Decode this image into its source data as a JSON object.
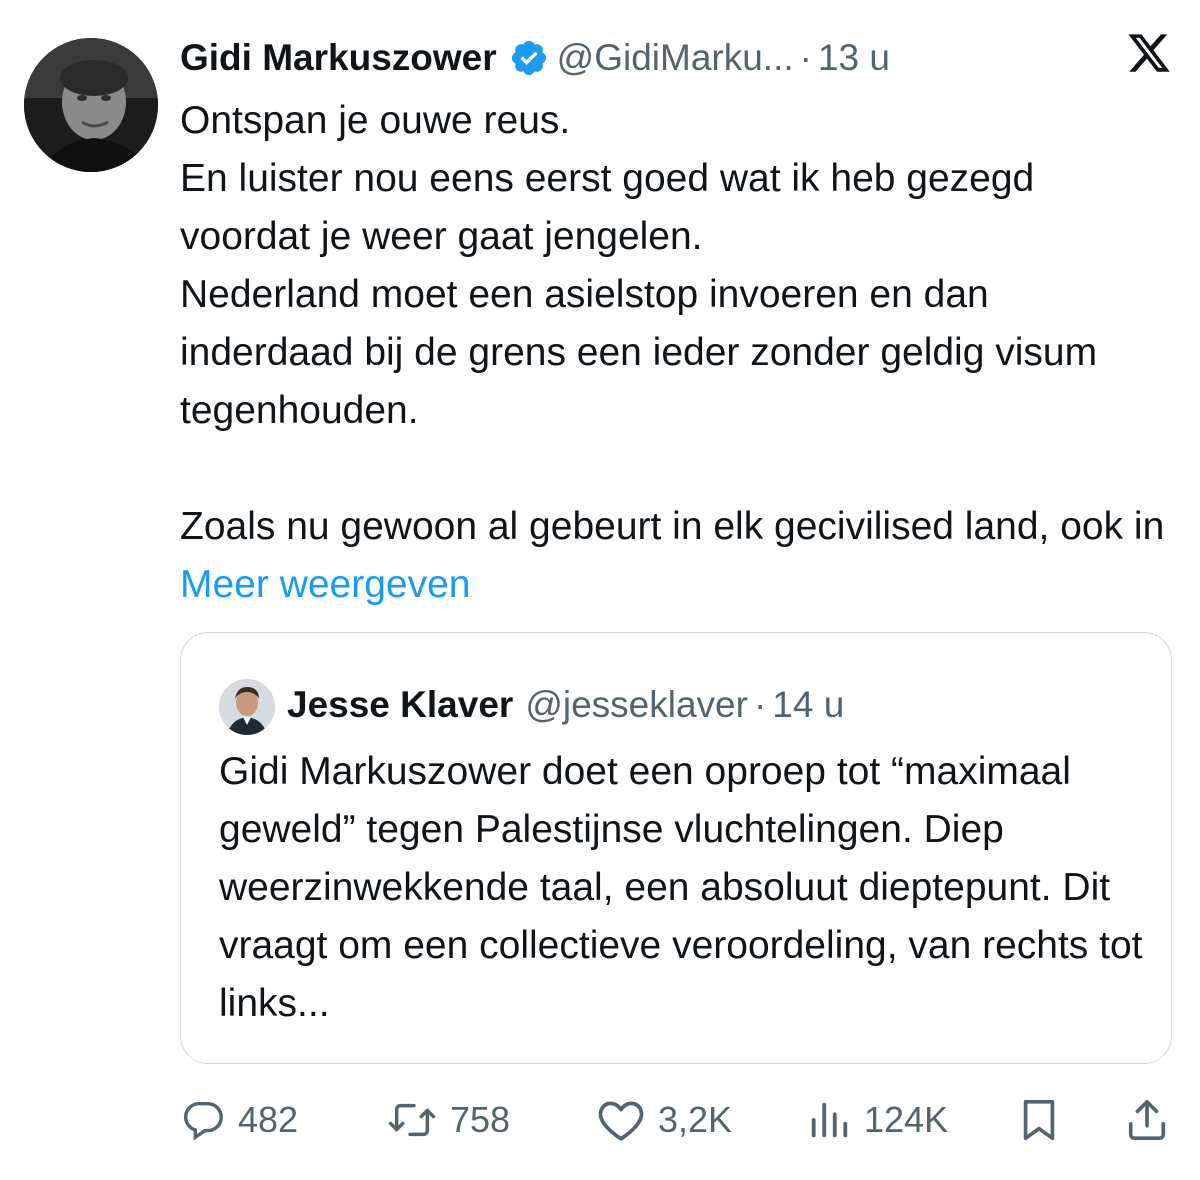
{
  "tweet": {
    "author_name": "Gidi Markuszower",
    "author_handle": "@GidiMarku...",
    "separator": "·",
    "time": "13 u",
    "lines": [
      "Ontspan je ouwe reus.",
      "En luister nou eens eerst goed wat ik heb gezegd voordat je weer gaat jengelen.",
      "Nederland moet een asielstop invoeren en dan inderdaad bij de grens een ieder zonder geldig visum tegenhouden."
    ],
    "paragraph2": "Zoals nu gewoon al gebeurt in elk gecivilised land, ook in",
    "show_more": "Meer weergeven"
  },
  "quoted": {
    "author_name": "Jesse Klaver",
    "author_handle": "@jesseklaver",
    "separator": "·",
    "time": "14 u",
    "text": "Gidi Markuszower doet een oproep tot “maximaal geweld” tegen Palestijnse vluchtelingen. Diep weerzinwekkende taal, een absoluut dieptepunt. Dit vraagt om een collectieve veroordeling, van rechts tot links..."
  },
  "actions": {
    "replies": "482",
    "reposts": "758",
    "likes": "3,2K",
    "views": "124K"
  },
  "icons": {
    "verified": "verified-badge-icon",
    "logo": "x-logo-icon",
    "reply": "reply-icon",
    "repost": "repost-icon",
    "like": "heart-icon",
    "views": "views-icon",
    "bookmark": "bookmark-icon",
    "share": "share-icon"
  },
  "colors": {
    "accent": "#1d9bf0",
    "secondary_text": "#536471",
    "border": "#cfd9de"
  }
}
